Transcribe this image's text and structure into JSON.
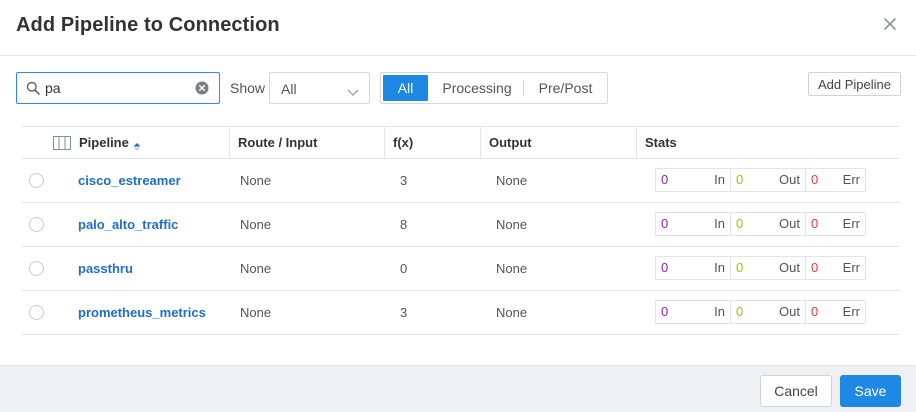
{
  "dialog": {
    "title": "Add Pipeline to Connection"
  },
  "toolbar": {
    "search_value": "pa",
    "show_label": "Show",
    "show_selected": "All",
    "segments": [
      "All",
      "Processing",
      "Pre/Post"
    ],
    "active_segment": "All",
    "add_pipeline_label": "Add Pipeline"
  },
  "table": {
    "columns": [
      "Pipeline",
      "Route / Input",
      "f(x)",
      "Output",
      "Stats"
    ],
    "rows": [
      {
        "pipeline": "cisco_estreamer",
        "route": "None",
        "fx": "3",
        "output": "None",
        "stats": {
          "in": "0",
          "in_label": "In",
          "out": "0",
          "out_label": "Out",
          "err": "0",
          "err_label": "Err"
        }
      },
      {
        "pipeline": "palo_alto_traffic",
        "route": "None",
        "fx": "8",
        "output": "None",
        "stats": {
          "in": "0",
          "in_label": "In",
          "out": "0",
          "out_label": "Out",
          "err": "0",
          "err_label": "Err"
        }
      },
      {
        "pipeline": "passthru",
        "route": "None",
        "fx": "0",
        "output": "None",
        "stats": {
          "in": "0",
          "in_label": "In",
          "out": "0",
          "out_label": "Out",
          "err": "0",
          "err_label": "Err"
        }
      },
      {
        "pipeline": "prometheus_metrics",
        "route": "None",
        "fx": "3",
        "output": "None",
        "stats": {
          "in": "0",
          "in_label": "In",
          "out": "0",
          "out_label": "Out",
          "err": "0",
          "err_label": "Err"
        }
      }
    ]
  },
  "footer": {
    "cancel_label": "Cancel",
    "save_label": "Save"
  },
  "colors": {
    "primary": "#1e88e5",
    "link": "#1e6fc8",
    "stat_in": "#8e24aa",
    "stat_out": "#9cc400",
    "stat_err": "#e53935"
  },
  "icons": {
    "close": "close-icon",
    "search": "search-icon",
    "clear": "clear-icon",
    "dropdown": "chevron-down-icon",
    "columns": "columns-icon",
    "sort": "sort-asc-icon"
  }
}
